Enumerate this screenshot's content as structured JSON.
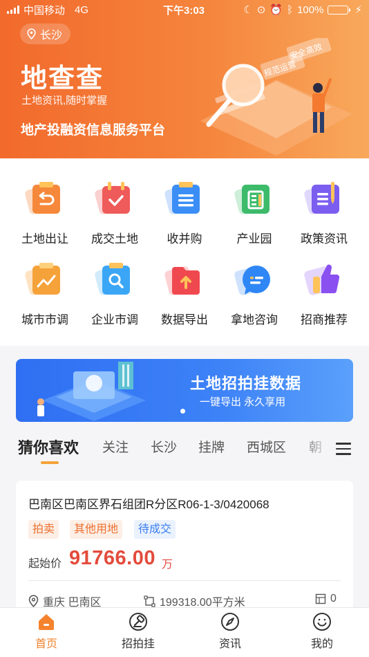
{
  "status_bar": {
    "carrier": "中国移动",
    "network": "4G",
    "time": "下午3:03",
    "battery": "100%"
  },
  "hero": {
    "location": "长沙",
    "brand": "地查查",
    "slogan": "土地资讯,随时掌握",
    "subtitle": "地产投融资信息服务平台",
    "sign_left": "规范运营",
    "sign_right": "安全高效"
  },
  "features": [
    {
      "label": "土地出让",
      "icon": "land-transfer-icon",
      "color": "#f5883a"
    },
    {
      "label": "成交土地",
      "icon": "deal-land-icon",
      "color": "#ef5a5a"
    },
    {
      "label": "收并购",
      "icon": "merger-icon",
      "color": "#3b8ef5"
    },
    {
      "label": "产业园",
      "icon": "industrial-park-icon",
      "color": "#3dbb6b"
    },
    {
      "label": "政策资讯",
      "icon": "policy-news-icon",
      "color": "#7b5ef0"
    },
    {
      "label": "城市市调",
      "icon": "city-survey-icon",
      "color": "#f5a23a"
    },
    {
      "label": "企业市调",
      "icon": "enterprise-survey-icon",
      "color": "#3ba6f5"
    },
    {
      "label": "数据导出",
      "icon": "data-export-icon",
      "color": "#f0484f"
    },
    {
      "label": "拿地咨询",
      "icon": "consult-icon",
      "color": "#2f86f5"
    },
    {
      "label": "招商推荐",
      "icon": "recommend-icon",
      "color": "#8a50f0"
    }
  ],
  "promo": {
    "title": "土地招拍挂数据",
    "subtitle": "一键导出 永久享用"
  },
  "tabs": [
    {
      "label": "猜你喜欢",
      "active": true
    },
    {
      "label": "关注"
    },
    {
      "label": "长沙"
    },
    {
      "label": "挂牌"
    },
    {
      "label": "西城区"
    },
    {
      "label": "朝"
    }
  ],
  "card": {
    "title": "巴南区巴南区界石组团R分区R06-1-3/0420068",
    "tags": [
      "拍卖",
      "其他用地",
      "待成交"
    ],
    "price_label": "起始价",
    "price": "91766.00",
    "price_unit": "万",
    "location": "重庆 巴南区",
    "area": "199318.00平方米",
    "count": "0"
  },
  "bottom_nav": [
    {
      "label": "首页",
      "icon": "home-icon",
      "active": true
    },
    {
      "label": "招拍挂",
      "icon": "auction-icon"
    },
    {
      "label": "资讯",
      "icon": "compass-icon"
    },
    {
      "label": "我的",
      "icon": "profile-icon"
    }
  ],
  "colors": {
    "brand_orange": "#f26a2c",
    "price_red": "#e34b3c",
    "promo_blue": "#2f6ff2"
  }
}
